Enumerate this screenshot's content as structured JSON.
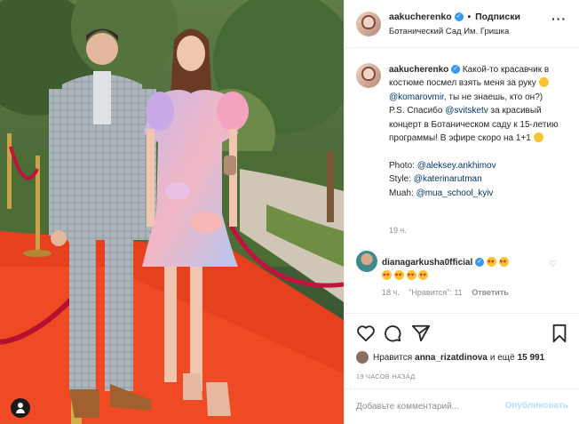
{
  "photo": {
    "alt_icon": "user-tag-icon"
  },
  "header": {
    "username": "aakucherenko",
    "separator": "•",
    "follow_label": "Подписки",
    "location": "Ботанический Сад Им. Гришка",
    "more_label": "···"
  },
  "caption": {
    "username": "aakucherenko",
    "line_1": "Какой-то красавчик в костюме посмел взять меня за руку",
    "mention_1": "@komarovmir",
    "line_2": ", ты не знаешь, кто он?)",
    "line_3": "P.S. Спасибо",
    "mention_2": "@svitsketv",
    "line_4": "за красивый концерт в Ботаническом саду к 15-летию программы! В эфире скоро на 1+1",
    "photo_label": "Photo:",
    "photo_mention": "@aleksey.ankhimov",
    "style_label": "Style:",
    "style_mention": "@katerinarutman",
    "muah_label": "Muah:",
    "muah_mention": "@mua_school_kyiv",
    "time": "19 ч."
  },
  "comment": {
    "username": "dianagarkusha0fficial",
    "time": "18 ч.",
    "likes": "\"Нравится\": 11",
    "reply_label": "Ответить"
  },
  "actions": {
    "likes_prefix": "Нравится",
    "likes_user": "anna_rizatdinova",
    "likes_and": "и ещё",
    "likes_count": "15 991",
    "posted": "19 ЧАСОВ НАЗАД"
  },
  "add_comment": {
    "placeholder": "Добавьте комментарий...",
    "publish_label": "Опубликовать"
  },
  "colors": {
    "link": "#00376b",
    "verified": "#3897f0",
    "muted": "#8e8e8e",
    "publish_disabled": "#b2dffc"
  }
}
